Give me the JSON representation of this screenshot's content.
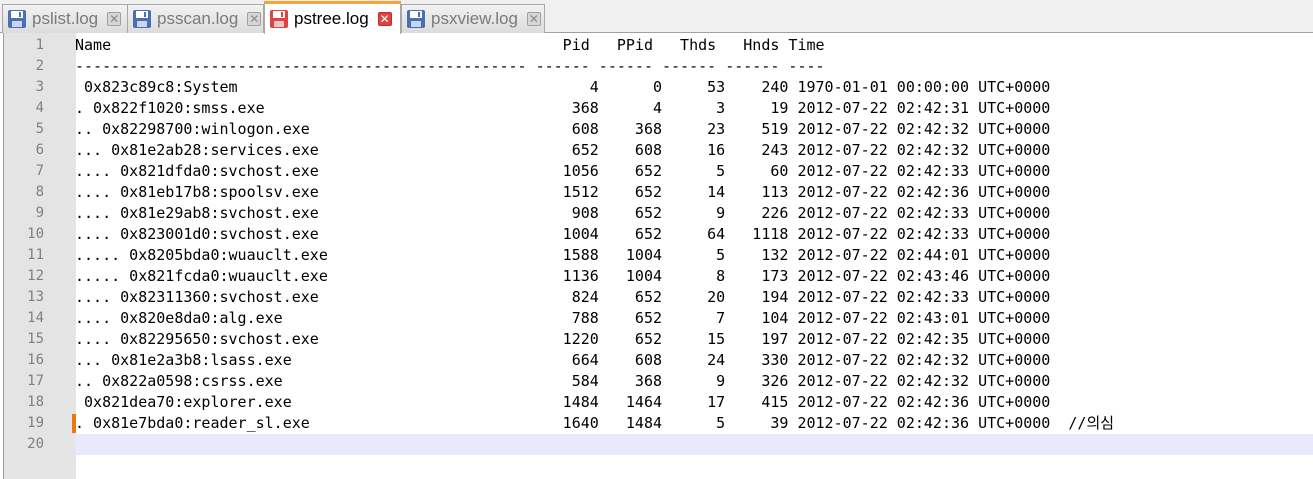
{
  "tabs": [
    {
      "title": "pslist.log",
      "active": false,
      "icon": "floppy-save-icon"
    },
    {
      "title": "psscan.log",
      "active": false,
      "icon": "floppy-save-icon"
    },
    {
      "title": "pstree.log",
      "active": true,
      "icon": "floppy-unsaved-icon"
    },
    {
      "title": "psxview.log",
      "active": false,
      "icon": "floppy-save-icon"
    }
  ],
  "close_glyph": "✕",
  "colors": {
    "saved_icon": "#4a6fb5",
    "unsaved_icon": "#e04343",
    "active_tab_accent": "#f8a23c",
    "current_line": "#e8e8ff",
    "change_marker": "#f0780a"
  },
  "editor": {
    "current_line": 20,
    "changed_line": 19,
    "lines": [
      "Name                                                  Pid   PPid   Thds   Hnds Time",
      "-------------------------------------------------- ------ ------ ------ ------ ----",
      " 0x823c89c8:System                                       4      0     53    240 1970-01-01 00:00:00 UTC+0000",
      ". 0x822f1020:smss.exe                                  368      4      3     19 2012-07-22 02:42:31 UTC+0000",
      ".. 0x82298700:winlogon.exe                             608    368     23    519 2012-07-22 02:42:32 UTC+0000",
      "... 0x81e2ab28:services.exe                            652    608     16    243 2012-07-22 02:42:32 UTC+0000",
      ".... 0x821dfda0:svchost.exe                           1056    652      5     60 2012-07-22 02:42:33 UTC+0000",
      ".... 0x81eb17b8:spoolsv.exe                           1512    652     14    113 2012-07-22 02:42:36 UTC+0000",
      ".... 0x81e29ab8:svchost.exe                            908    652      9    226 2012-07-22 02:42:33 UTC+0000",
      ".... 0x823001d0:svchost.exe                           1004    652     64   1118 2012-07-22 02:42:33 UTC+0000",
      "..... 0x8205bda0:wuauclt.exe                          1588   1004      5    132 2012-07-22 02:44:01 UTC+0000",
      "..... 0x821fcda0:wuauclt.exe                          1136   1004      8    173 2012-07-22 02:43:46 UTC+0000",
      ".... 0x82311360:svchost.exe                            824    652     20    194 2012-07-22 02:42:33 UTC+0000",
      ".... 0x820e8da0:alg.exe                                788    652      7    104 2012-07-22 02:43:01 UTC+0000",
      ".... 0x82295650:svchost.exe                           1220    652     15    197 2012-07-22 02:42:35 UTC+0000",
      "... 0x81e2a3b8:lsass.exe                               664    608     24    330 2012-07-22 02:42:32 UTC+0000",
      ".. 0x822a0598:csrss.exe                                584    368      9    326 2012-07-22 02:42:32 UTC+0000",
      " 0x821dea70:explorer.exe                              1484   1464     17    415 2012-07-22 02:42:36 UTC+0000",
      ". 0x81e7bda0:reader_sl.exe                            1640   1484      5     39 2012-07-22 02:42:36 UTC+0000  //의심",
      ""
    ]
  }
}
